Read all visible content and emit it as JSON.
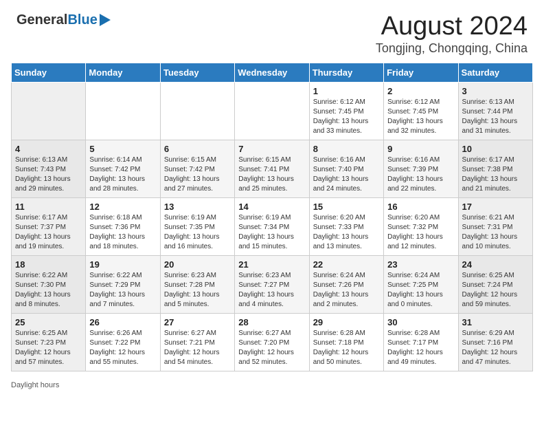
{
  "header": {
    "logo_general": "General",
    "logo_blue": "Blue",
    "month_year": "August 2024",
    "location": "Tongjing, Chongqing, China"
  },
  "weekdays": [
    "Sunday",
    "Monday",
    "Tuesday",
    "Wednesday",
    "Thursday",
    "Friday",
    "Saturday"
  ],
  "footer": {
    "daylight_label": "Daylight hours"
  },
  "weeks": [
    [
      {
        "day": "",
        "info": ""
      },
      {
        "day": "",
        "info": ""
      },
      {
        "day": "",
        "info": ""
      },
      {
        "day": "",
        "info": ""
      },
      {
        "day": "1",
        "info": "Sunrise: 6:12 AM\nSunset: 7:45 PM\nDaylight: 13 hours and 33 minutes."
      },
      {
        "day": "2",
        "info": "Sunrise: 6:12 AM\nSunset: 7:45 PM\nDaylight: 13 hours and 32 minutes."
      },
      {
        "day": "3",
        "info": "Sunrise: 6:13 AM\nSunset: 7:44 PM\nDaylight: 13 hours and 31 minutes."
      }
    ],
    [
      {
        "day": "4",
        "info": "Sunrise: 6:13 AM\nSunset: 7:43 PM\nDaylight: 13 hours and 29 minutes."
      },
      {
        "day": "5",
        "info": "Sunrise: 6:14 AM\nSunset: 7:42 PM\nDaylight: 13 hours and 28 minutes."
      },
      {
        "day": "6",
        "info": "Sunrise: 6:15 AM\nSunset: 7:42 PM\nDaylight: 13 hours and 27 minutes."
      },
      {
        "day": "7",
        "info": "Sunrise: 6:15 AM\nSunset: 7:41 PM\nDaylight: 13 hours and 25 minutes."
      },
      {
        "day": "8",
        "info": "Sunrise: 6:16 AM\nSunset: 7:40 PM\nDaylight: 13 hours and 24 minutes."
      },
      {
        "day": "9",
        "info": "Sunrise: 6:16 AM\nSunset: 7:39 PM\nDaylight: 13 hours and 22 minutes."
      },
      {
        "day": "10",
        "info": "Sunrise: 6:17 AM\nSunset: 7:38 PM\nDaylight: 13 hours and 21 minutes."
      }
    ],
    [
      {
        "day": "11",
        "info": "Sunrise: 6:17 AM\nSunset: 7:37 PM\nDaylight: 13 hours and 19 minutes."
      },
      {
        "day": "12",
        "info": "Sunrise: 6:18 AM\nSunset: 7:36 PM\nDaylight: 13 hours and 18 minutes."
      },
      {
        "day": "13",
        "info": "Sunrise: 6:19 AM\nSunset: 7:35 PM\nDaylight: 13 hours and 16 minutes."
      },
      {
        "day": "14",
        "info": "Sunrise: 6:19 AM\nSunset: 7:34 PM\nDaylight: 13 hours and 15 minutes."
      },
      {
        "day": "15",
        "info": "Sunrise: 6:20 AM\nSunset: 7:33 PM\nDaylight: 13 hours and 13 minutes."
      },
      {
        "day": "16",
        "info": "Sunrise: 6:20 AM\nSunset: 7:32 PM\nDaylight: 13 hours and 12 minutes."
      },
      {
        "day": "17",
        "info": "Sunrise: 6:21 AM\nSunset: 7:31 PM\nDaylight: 13 hours and 10 minutes."
      }
    ],
    [
      {
        "day": "18",
        "info": "Sunrise: 6:22 AM\nSunset: 7:30 PM\nDaylight: 13 hours and 8 minutes."
      },
      {
        "day": "19",
        "info": "Sunrise: 6:22 AM\nSunset: 7:29 PM\nDaylight: 13 hours and 7 minutes."
      },
      {
        "day": "20",
        "info": "Sunrise: 6:23 AM\nSunset: 7:28 PM\nDaylight: 13 hours and 5 minutes."
      },
      {
        "day": "21",
        "info": "Sunrise: 6:23 AM\nSunset: 7:27 PM\nDaylight: 13 hours and 4 minutes."
      },
      {
        "day": "22",
        "info": "Sunrise: 6:24 AM\nSunset: 7:26 PM\nDaylight: 13 hours and 2 minutes."
      },
      {
        "day": "23",
        "info": "Sunrise: 6:24 AM\nSunset: 7:25 PM\nDaylight: 13 hours and 0 minutes."
      },
      {
        "day": "24",
        "info": "Sunrise: 6:25 AM\nSunset: 7:24 PM\nDaylight: 12 hours and 59 minutes."
      }
    ],
    [
      {
        "day": "25",
        "info": "Sunrise: 6:25 AM\nSunset: 7:23 PM\nDaylight: 12 hours and 57 minutes."
      },
      {
        "day": "26",
        "info": "Sunrise: 6:26 AM\nSunset: 7:22 PM\nDaylight: 12 hours and 55 minutes."
      },
      {
        "day": "27",
        "info": "Sunrise: 6:27 AM\nSunset: 7:21 PM\nDaylight: 12 hours and 54 minutes."
      },
      {
        "day": "28",
        "info": "Sunrise: 6:27 AM\nSunset: 7:20 PM\nDaylight: 12 hours and 52 minutes."
      },
      {
        "day": "29",
        "info": "Sunrise: 6:28 AM\nSunset: 7:18 PM\nDaylight: 12 hours and 50 minutes."
      },
      {
        "day": "30",
        "info": "Sunrise: 6:28 AM\nSunset: 7:17 PM\nDaylight: 12 hours and 49 minutes."
      },
      {
        "day": "31",
        "info": "Sunrise: 6:29 AM\nSunset: 7:16 PM\nDaylight: 12 hours and 47 minutes."
      }
    ]
  ]
}
